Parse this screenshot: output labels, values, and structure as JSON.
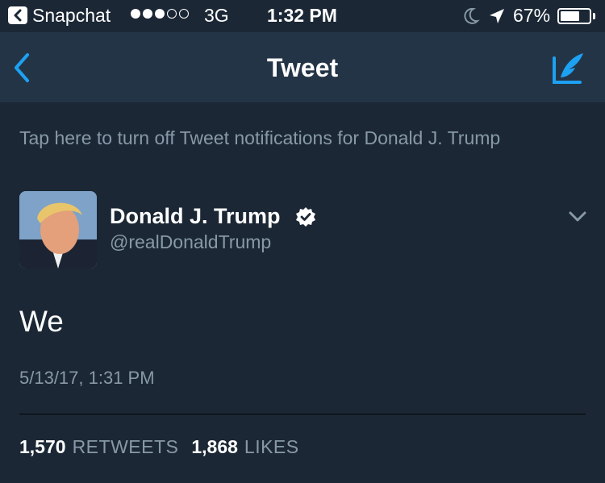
{
  "status_bar": {
    "back_app": "Snapchat",
    "network": "3G",
    "time": "1:32 PM",
    "battery_percent": "67%",
    "battery_level": 0.67,
    "signal_bars_filled": 3,
    "signal_bars_total": 5
  },
  "nav": {
    "title": "Tweet",
    "accent_color": "#1da1f2"
  },
  "notice": {
    "text": "Tap here to turn off Tweet notifications for Donald J. Trump"
  },
  "tweet": {
    "author_name": "Donald J. Trump",
    "author_handle": "@realDonaldTrump",
    "verified": true,
    "text": "We",
    "timestamp": "5/13/17, 1:31 PM",
    "retweets_count": "1,570",
    "retweets_label": "RETWEETS",
    "likes_count": "1,868",
    "likes_label": "LIKES"
  },
  "icons": {
    "back": "chevron-left-icon",
    "compose": "compose-tweet-icon",
    "verified": "verified-badge-icon",
    "menu": "chevron-down-icon",
    "moon": "moon-icon",
    "location": "location-arrow-icon"
  },
  "colors": {
    "background": "#1b2735",
    "navbar": "#243447",
    "secondary_text": "#8899a6",
    "primary_text": "#ffffff"
  }
}
